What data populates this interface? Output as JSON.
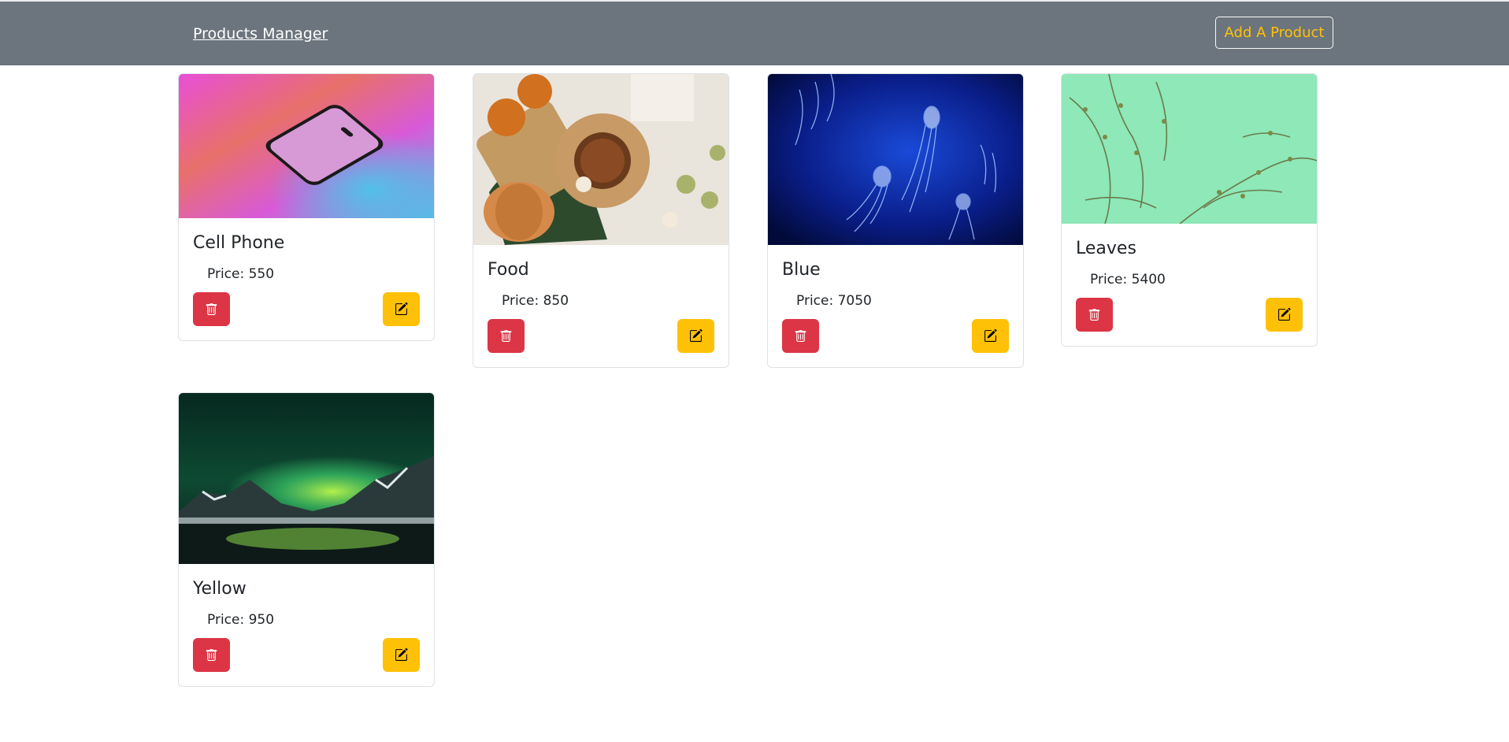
{
  "navbar": {
    "brand": "Products Manager",
    "add_button": "Add A Product"
  },
  "colors": {
    "navbar_bg": "#6c757d",
    "delete": "#dc3545",
    "edit": "#ffc107",
    "add_button_text": "#ffc107"
  },
  "products": [
    {
      "name": "Cell Phone",
      "price": "Price: 550",
      "image": "phone-photo"
    },
    {
      "name": "Food",
      "price": "Price: 850",
      "image": "food-photo"
    },
    {
      "name": "Blue",
      "price": "Price: 7050",
      "image": "jellyfish-photo"
    },
    {
      "name": "Leaves",
      "price": "Price: 5400",
      "image": "leaves-photo"
    },
    {
      "name": "Yellow",
      "price": "Price: 950",
      "image": "aurora-photo"
    }
  ],
  "icons": {
    "delete": "trash-icon",
    "edit": "edit-icon"
  }
}
